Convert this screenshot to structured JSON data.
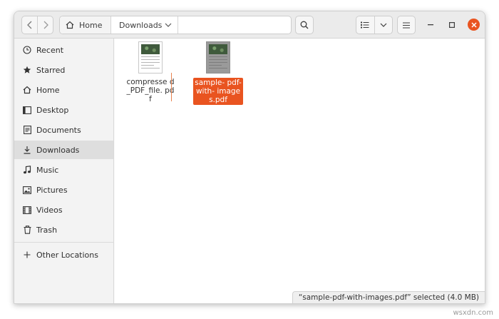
{
  "toolbar": {
    "back_icon": "chevron-left-icon",
    "forward_icon": "chevron-right-icon",
    "path": [
      {
        "label": "Home",
        "icon": "home-icon"
      },
      {
        "label": "Downloads",
        "icon": "chevron-down-icon"
      }
    ],
    "search_icon": "search-icon",
    "view_icon": "list-view-icon",
    "view_options_icon": "chevron-down-icon",
    "menu_icon": "hamburger-menu-icon",
    "window_controls": [
      "minimize-icon",
      "maximize-icon",
      "close-icon"
    ],
    "accent_color": "#e95420"
  },
  "sidebar": {
    "items": [
      {
        "label": "Recent",
        "icon": "clock-icon"
      },
      {
        "label": "Starred",
        "icon": "star-icon"
      },
      {
        "label": "Home",
        "icon": "home-icon"
      },
      {
        "label": "Desktop",
        "icon": "desktop-icon"
      },
      {
        "label": "Documents",
        "icon": "document-icon"
      },
      {
        "label": "Downloads",
        "icon": "download-icon",
        "active": true
      },
      {
        "label": "Music",
        "icon": "music-icon"
      },
      {
        "label": "Pictures",
        "icon": "picture-icon"
      },
      {
        "label": "Videos",
        "icon": "video-icon"
      },
      {
        "label": "Trash",
        "icon": "trash-icon"
      }
    ],
    "other_locations": {
      "label": "Other Locations",
      "icon": "plus-icon"
    }
  },
  "files": [
    {
      "name": "compresse d_PDF_file. pdf",
      "selected": false
    },
    {
      "name": "sample- pdf-with- images.pdf",
      "selected": true
    }
  ],
  "status": {
    "text": "“sample-pdf-with-images.pdf” selected  (4.0 MB)"
  },
  "watermark": {
    "text": "wsxdn.com"
  }
}
